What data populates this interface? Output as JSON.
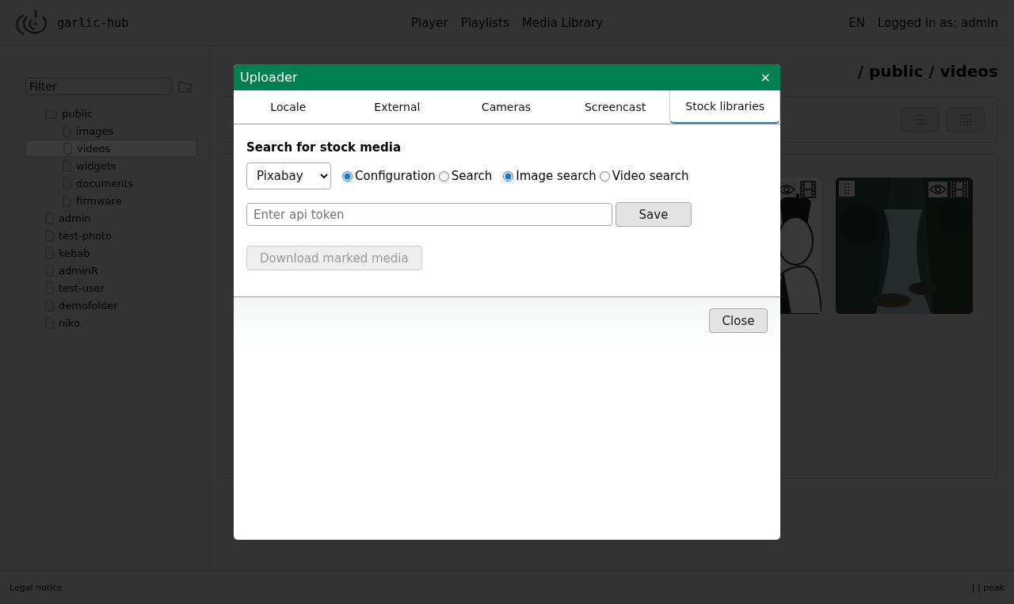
{
  "header": {
    "logo_text": "garlic-hub",
    "nav": [
      {
        "label": "Player"
      },
      {
        "label": "Playlists"
      },
      {
        "label": "Media Library"
      }
    ],
    "language": "EN",
    "user": "Logged in as: admin"
  },
  "sidebar": {
    "filter_placeholder": "Filter",
    "tree": [
      {
        "label": "public",
        "kind": "folder",
        "selected": false,
        "children": [
          {
            "label": "images",
            "kind": "file",
            "selected": false
          },
          {
            "label": "videos",
            "kind": "file",
            "selected": true
          },
          {
            "label": "widgets",
            "kind": "file",
            "selected": false
          },
          {
            "label": "documents",
            "kind": "file",
            "selected": false
          },
          {
            "label": "firmware",
            "kind": "file",
            "selected": false
          }
        ]
      },
      {
        "label": "admin",
        "kind": "file",
        "selected": false
      },
      {
        "label": "test-photo",
        "kind": "file",
        "selected": false
      },
      {
        "label": "kebab",
        "kind": "file",
        "selected": false
      },
      {
        "label": "adminR",
        "kind": "file",
        "selected": false
      },
      {
        "label": "test-user",
        "kind": "file",
        "selected": false
      },
      {
        "label": "demofolder",
        "kind": "file",
        "selected": false
      },
      {
        "label": "niko",
        "kind": "file",
        "selected": false
      }
    ]
  },
  "main": {
    "breadcrumb": "/ public / videos"
  },
  "dialog": {
    "title": "Uploader",
    "close_glyph": "×",
    "tabs": [
      {
        "label": "Locale",
        "selected": false
      },
      {
        "label": "External",
        "selected": false
      },
      {
        "label": "Cameras",
        "selected": false
      },
      {
        "label": "Screencast",
        "selected": false
      },
      {
        "label": "Stock libraries",
        "selected": true
      }
    ],
    "heading": "Search for stock media",
    "library": "Pixabay",
    "mode_radios": [
      {
        "label": "Configuration",
        "selected": true
      },
      {
        "label": "Search",
        "selected": false
      }
    ],
    "type_radios": [
      {
        "label": "Image search",
        "selected": true
      },
      {
        "label": "Video search",
        "selected": false
      }
    ],
    "token_placeholder": "Enter api token",
    "save_label": "Save",
    "download": {
      "label": "Download marked media",
      "disabled": true
    },
    "close_label": "Close"
  },
  "footer": {
    "left": "Legal notice",
    "right": "| | peak"
  }
}
